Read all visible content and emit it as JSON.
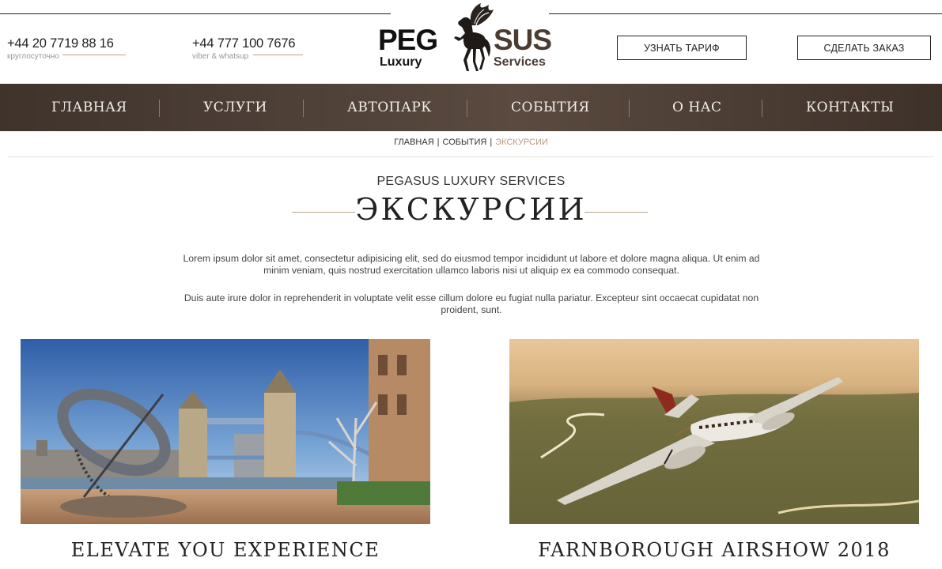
{
  "header": {
    "phones": [
      {
        "number": "+44 20 7719 88 16",
        "note": "круглосуточно"
      },
      {
        "number": "+44 777 100 7676",
        "note": "viber & whatsup"
      }
    ],
    "logo": {
      "word_left": "PEG",
      "word_right": "SUS",
      "line_left": "Luxury",
      "line_right": "Services",
      "icon": "pegasus-horse-icon"
    },
    "buttons": {
      "tariff": "УЗНАТЬ ТАРИФ",
      "order": "СДЕЛАТЬ ЗАКАЗ"
    }
  },
  "nav": {
    "items": [
      "ГЛАВНАЯ",
      "УСЛУГИ",
      "АВТОПАРК",
      "СОБЫТИЯ",
      "О НАС",
      "КОНТАКТЫ"
    ]
  },
  "breadcrumb": {
    "items": [
      "ГЛАВНАЯ",
      "СОБЫТИЯ",
      "ЭКСКУРСИИ"
    ],
    "separator": "|"
  },
  "page": {
    "subtitle": "PEGASUS LUXURY SERVICES",
    "title": "ЭКСКУРСИИ",
    "paragraphs": [
      "Lorem ipsum dolor sit amet, consectetur adipisicing elit, sed do eiusmod tempor incididunt ut labore et dolore magna aliqua. Ut enim ad minim veniam, quis nostrud exercitation ullamco laboris nisi ut aliquip ex ea commodo consequat.",
      "Duis aute irure dolor in reprehenderit in voluptate velit esse cillum dolore eu fugiat nulla pariatur. Excepteur sint occaecat cupidatat non proident, sunt."
    ]
  },
  "cards": [
    {
      "title": "ELEVATE YOU EXPERIENCE",
      "image": "tower-bridge-sundial-photo"
    },
    {
      "title": "FARNBOROUGH AIRSHOW 2018",
      "image": "private-plane-sunset-photo"
    }
  ],
  "colors": {
    "nav_bg": "#4a3d35",
    "accent": "#b9a38b",
    "text": "#222222"
  }
}
